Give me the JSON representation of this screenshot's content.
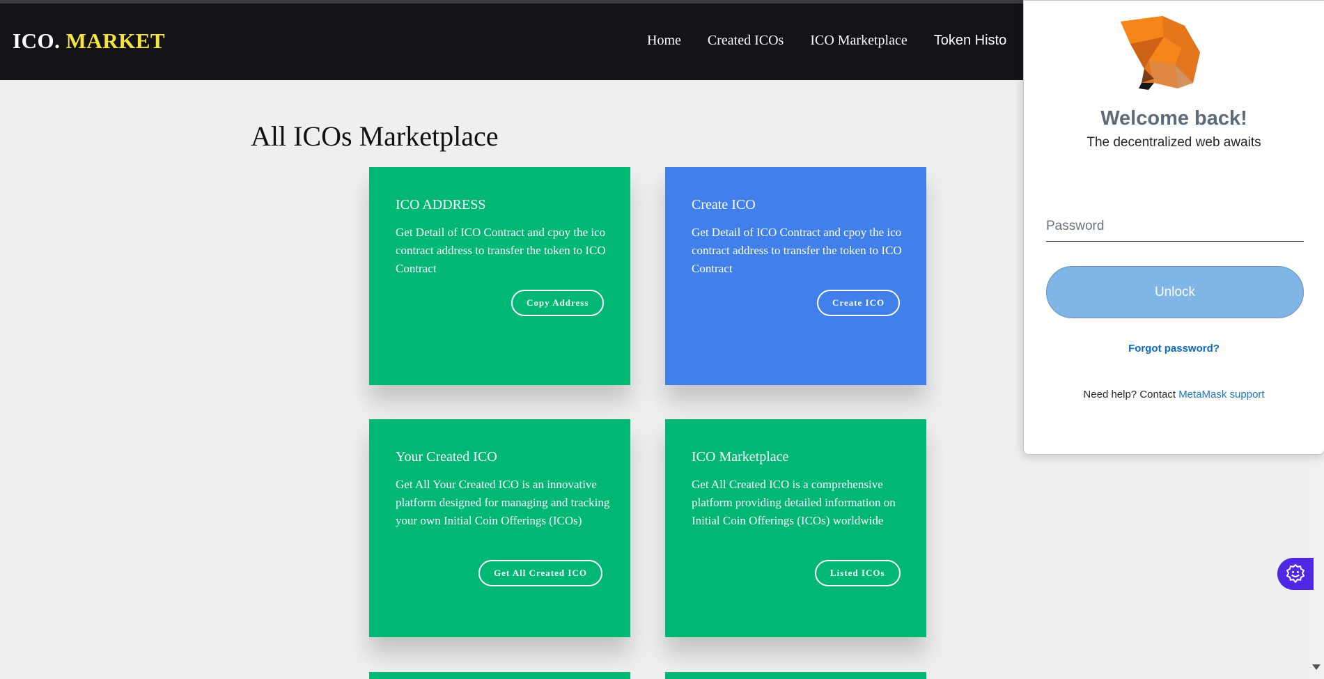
{
  "navbar": {
    "logo_prefix": "ICO.",
    "logo_suffix": "MARKET",
    "links": [
      "Home",
      "Created ICOs",
      "ICO Marketplace",
      "Token Histo"
    ]
  },
  "page": {
    "title": "All ICOs Marketplace"
  },
  "cards": [
    {
      "title": "ICO ADDRESS",
      "description": "Get Detail of ICO Contract and cpoy the ico contract address to transfer the token to ICO Contract",
      "button": "Copy Address",
      "color": "#00b874"
    },
    {
      "title": "Create ICO",
      "description": "Get Detail of ICO Contract and cpoy the ico contract address to transfer the token to ICO Contract",
      "button": "Create ICO",
      "color": "#4180ea"
    },
    {
      "title": "Your Created ICO",
      "description": "Get All Your Created ICO is an innovative platform designed for managing and tracking your own Initial Coin Offerings (ICOs)",
      "button": "Get All Created ICO",
      "color": "#00b874"
    },
    {
      "title": "ICO Marketplace",
      "description": "Get All Created ICO is a comprehensive platform providing detailed information on Initial Coin Offerings (ICOs) worldwide",
      "button": "Listed ICOs",
      "color": "#00b874"
    }
  ],
  "metamask": {
    "welcome": "Welcome back!",
    "subtitle": "The decentralized web awaits",
    "password_placeholder": "Password",
    "unlock_label": "Unlock",
    "forgot_label": "Forgot password?",
    "help_text": "Need help? Contact",
    "support_link": "MetaMask support",
    "logo_icon": "metamask-fox-icon"
  },
  "floating_button": {
    "icon": "gear-smile-icon",
    "color": "#5127e6"
  }
}
